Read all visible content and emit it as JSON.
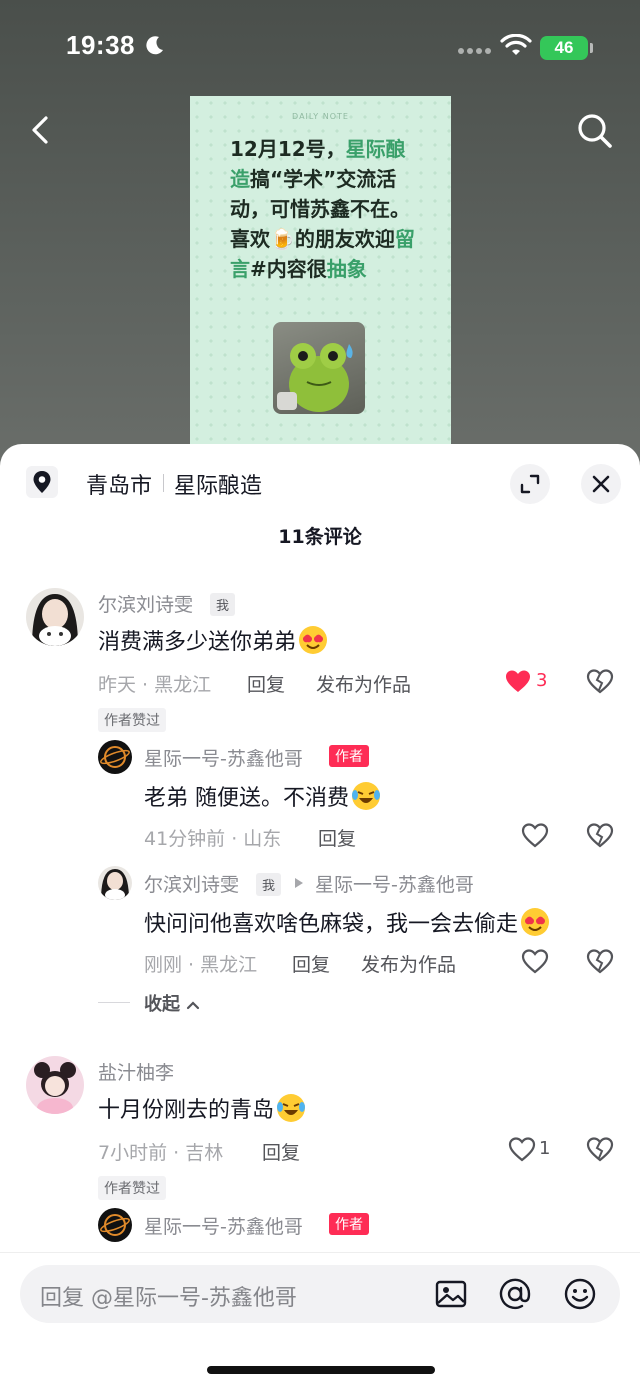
{
  "status_bar": {
    "time": "19:38",
    "battery": "46"
  },
  "note": {
    "tag": "DAILY NOTE",
    "segments": [
      {
        "t": "12月12号，",
        "hl": false
      },
      {
        "t": "星际酿造",
        "hl": true
      },
      {
        "t": "搞“学术”交流活动，可惜苏鑫不在。喜欢",
        "hl": false
      },
      {
        "t": "🍺",
        "hl": false
      },
      {
        "t": "的朋友欢迎",
        "hl": false
      },
      {
        "t": "留言",
        "hl": true
      },
      {
        "t": "#内容很",
        "hl": false
      },
      {
        "t": "抽象",
        "hl": true
      }
    ]
  },
  "location": {
    "city": "青岛市",
    "place": "星际酿造"
  },
  "comment_count": "11条评论",
  "comments": {
    "c1": {
      "user": "尔滨刘诗雯",
      "me_tag": "我",
      "text": "消费满多少送你弟弟",
      "time_loc": "昨天 · 黑龙江",
      "reply": "回复",
      "publish": "发布为作品",
      "likes": "3",
      "liked_by_author": "作者赞过"
    },
    "r1": {
      "user": "星际一号-苏鑫他哥",
      "author_tag": "作者",
      "text": "老弟 随便送。不消费",
      "time_loc": "41分钟前 · 山东",
      "reply": "回复"
    },
    "r2": {
      "user": "尔滨刘诗雯",
      "me_tag": "我",
      "reply_to": "星际一号-苏鑫他哥",
      "text": "快问问他喜欢啥色麻袋，我一会去偷走",
      "time_loc": "刚刚 · 黑龙江",
      "reply": "回复",
      "publish": "发布为作品"
    },
    "collapse": "收起",
    "c2": {
      "user": "盐汁柚李",
      "text": "十月份刚去的青岛",
      "time_loc": "7小时前 · 吉林",
      "reply": "回复",
      "likes": "1",
      "liked_by_author": "作者赞过"
    },
    "r3": {
      "user": "星际一号-苏鑫他哥",
      "author_tag": "作者"
    }
  },
  "input": {
    "placeholder": "回复 @星际一号-苏鑫他哥"
  },
  "colors": {
    "accent_red": "#fe2c55",
    "note_green": "#3aa06a",
    "battery_green": "#34c759"
  }
}
